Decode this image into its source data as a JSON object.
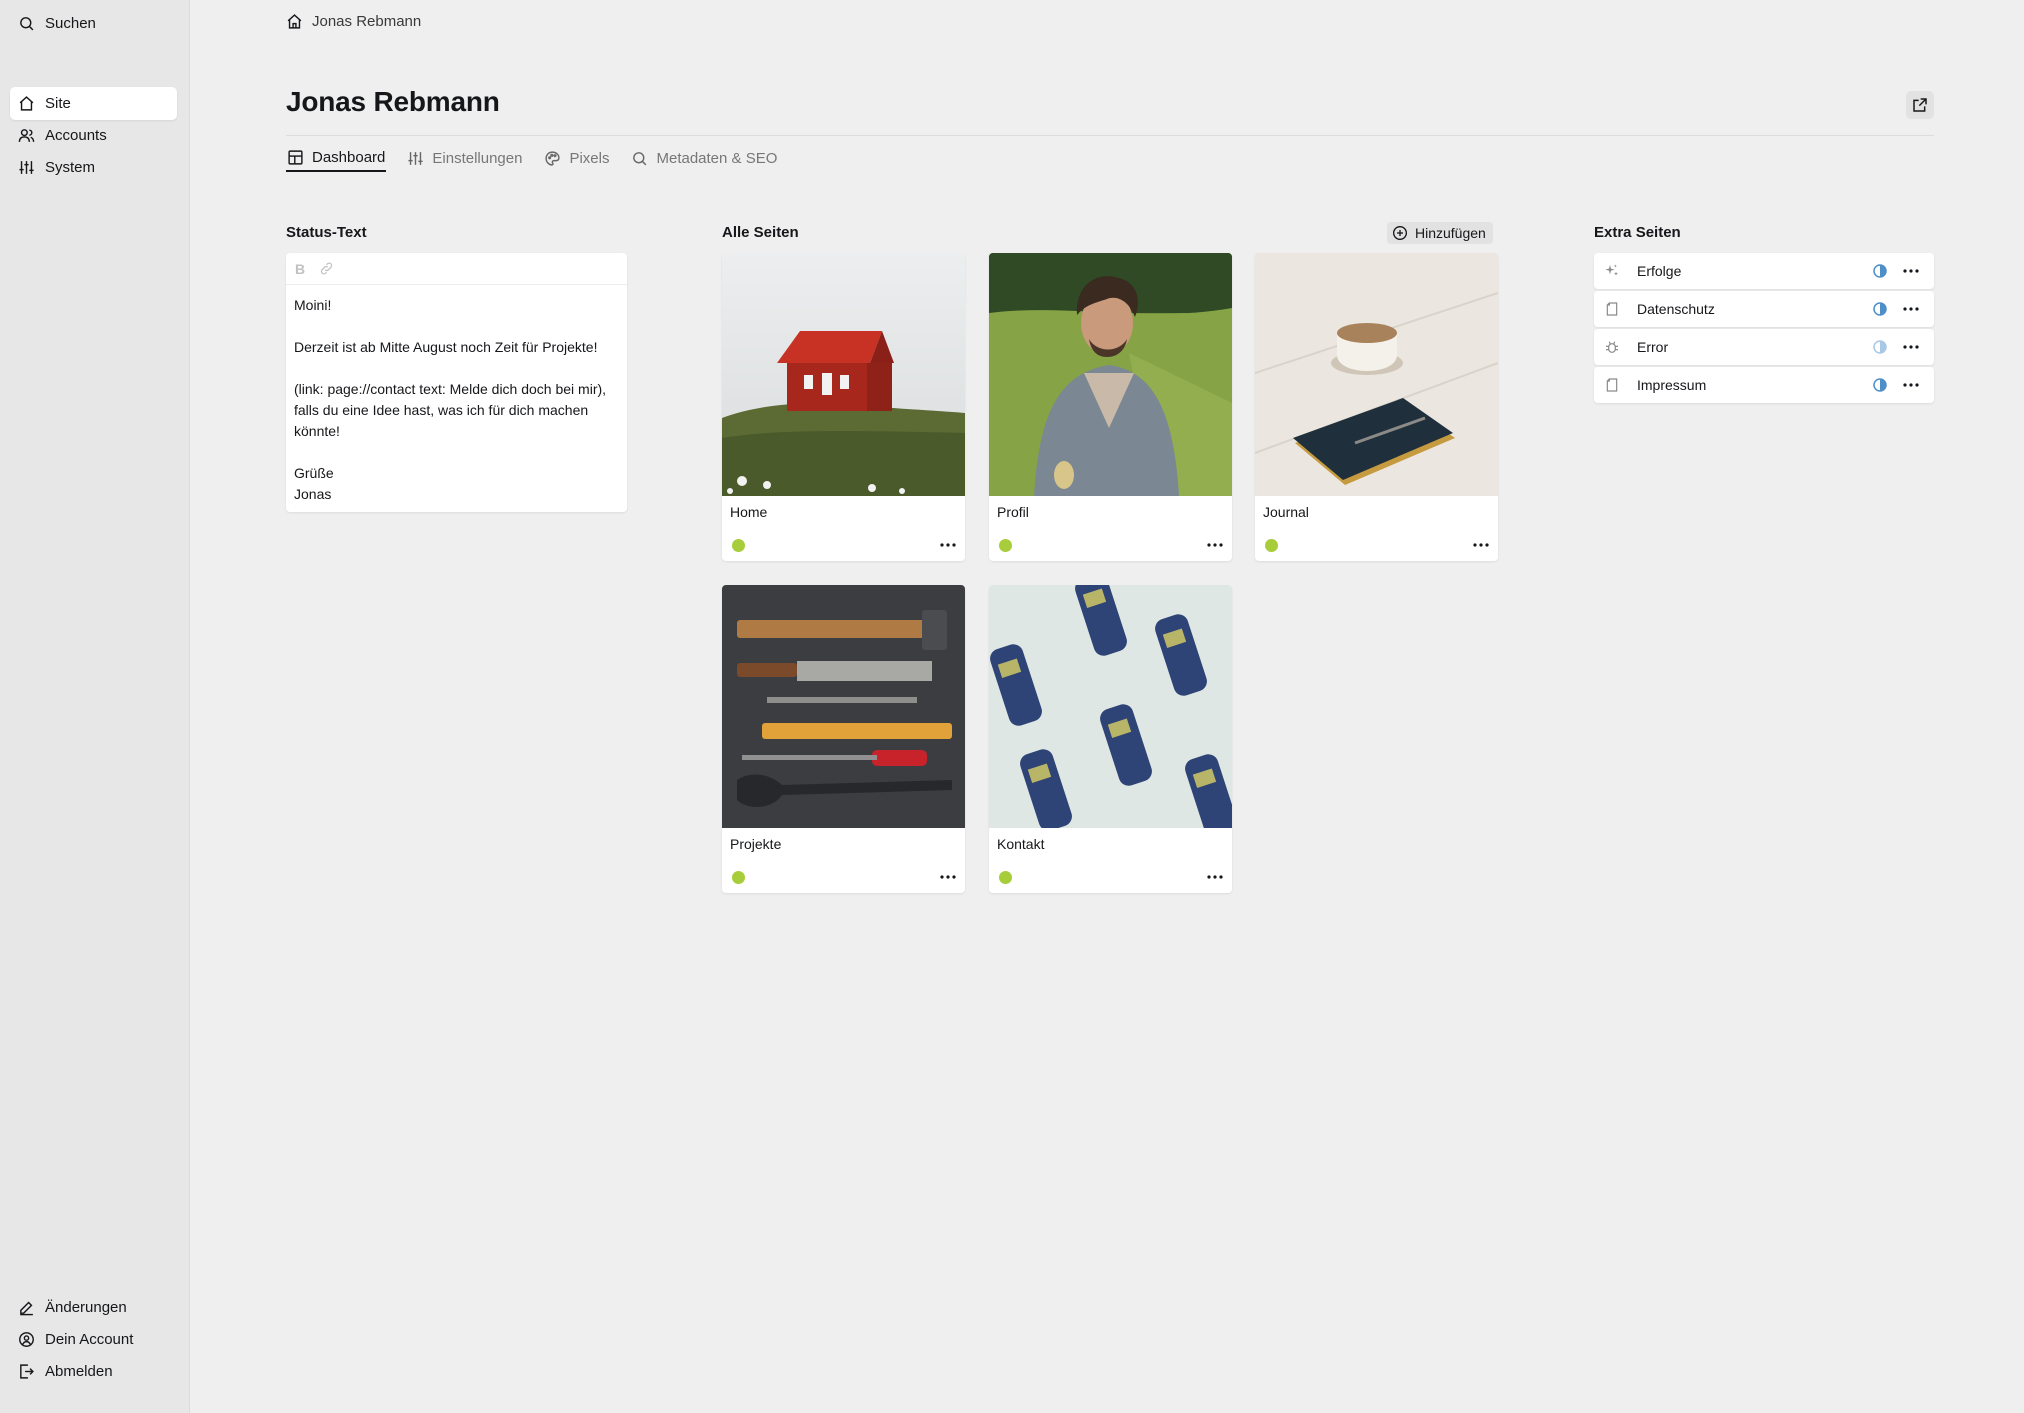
{
  "sidebar": {
    "search_label": "Suchen",
    "items": [
      {
        "label": "Site",
        "icon": "home-icon",
        "active": true
      },
      {
        "label": "Accounts",
        "icon": "users-icon"
      },
      {
        "label": "System",
        "icon": "sliders-icon"
      }
    ],
    "bottom_items": [
      {
        "label": "Änderungen",
        "icon": "pencil-icon"
      },
      {
        "label": "Dein Account",
        "icon": "user-circle-icon"
      },
      {
        "label": "Abmelden",
        "icon": "logout-icon"
      }
    ]
  },
  "breadcrumb": {
    "label": "Jonas Rebmann",
    "icon": "home-icon"
  },
  "header": {
    "title": "Jonas Rebmann",
    "open_icon": "external-link-icon"
  },
  "tabs": [
    {
      "label": "Dashboard",
      "icon": "dashboard-icon",
      "active": true
    },
    {
      "label": "Einstellungen",
      "icon": "sliders-icon"
    },
    {
      "label": "Pixels",
      "icon": "palette-icon"
    },
    {
      "label": "Metadaten & SEO",
      "icon": "search-icon"
    }
  ],
  "status_section": {
    "label": "Status-Text",
    "toolbar": {
      "bold_label": "B",
      "link_icon": "link-icon"
    },
    "paragraphs": [
      "Moini!",
      "Derzeit ist ab Mitte August noch Zeit für Projekte!",
      "(link: page://contact text: Melde dich doch bei mir), falls du eine Idee hast, was ich für dich machen könnte!",
      "Grüße\nJonas"
    ]
  },
  "pages_section": {
    "label": "Alle Seiten",
    "add_label": "Hinzufügen",
    "add_icon": "plus-circle-icon",
    "cards": [
      {
        "title": "Home",
        "status_color": "#a7cd3a",
        "image": "red-house-on-hill"
      },
      {
        "title": "Profil",
        "status_color": "#a7cd3a",
        "image": "man-portrait"
      },
      {
        "title": "Journal",
        "status_color": "#a7cd3a",
        "image": "notebook-and-coffee"
      },
      {
        "title": "Projekte",
        "status_color": "#a7cd3a",
        "image": "tools-flatlay"
      },
      {
        "title": "Kontakt",
        "status_color": "#a7cd3a",
        "image": "mobile-phones-pattern"
      }
    ]
  },
  "extra_section": {
    "label": "Extra Seiten",
    "items": [
      {
        "label": "Erfolge",
        "icon": "sparkles-icon",
        "status": "unlisted-icon"
      },
      {
        "label": "Datenschutz",
        "icon": "page-icon",
        "status": "unlisted-icon"
      },
      {
        "label": "Error",
        "icon": "bug-icon",
        "status": "unlisted-icon"
      },
      {
        "label": "Impressum",
        "icon": "page-icon",
        "status": "unlisted-icon"
      }
    ]
  },
  "colors": {
    "accent_status": "#a7cd3a",
    "unlisted": "#4e8ec9"
  }
}
